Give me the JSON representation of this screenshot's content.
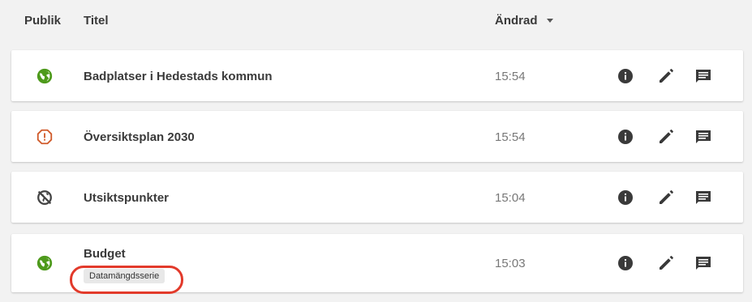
{
  "header": {
    "publik": "Publik",
    "titel": "Titel",
    "andrad": "Ändrad"
  },
  "colors": {
    "published": "#4e9a1c",
    "warning": "#d05a2a",
    "unpublished": "#444444",
    "highlight": "#e23a2b"
  },
  "rows": [
    {
      "status": "globe-icon",
      "title": "Badplatser i Hedestads kommun",
      "time": "15:54"
    },
    {
      "status": "warning-icon",
      "title": "Översiktsplan 2030",
      "time": "15:54"
    },
    {
      "status": "globe-off-icon",
      "title": "Utsiktspunkter",
      "time": "15:04"
    },
    {
      "status": "globe-icon",
      "title": "Budget",
      "tag": "Datamängdsserie",
      "time": "15:03"
    }
  ]
}
